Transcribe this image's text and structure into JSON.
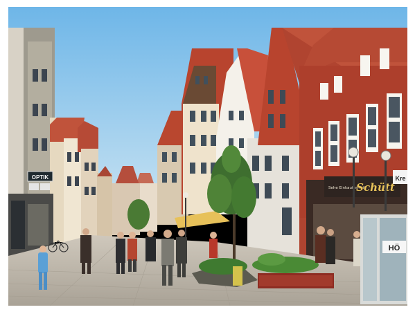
{
  "photo": {
    "signs": {
      "optik": "OPTIK",
      "schuett_small": "Sehe Einkaufen mit",
      "schuett": "Schütt",
      "kre": "Kre",
      "hoe": "HÖ"
    },
    "colors": {
      "sky": "#7fbfe6",
      "brick": "#b8442e",
      "roof": "#c8503a",
      "pavement": "#b9b2a6"
    }
  }
}
